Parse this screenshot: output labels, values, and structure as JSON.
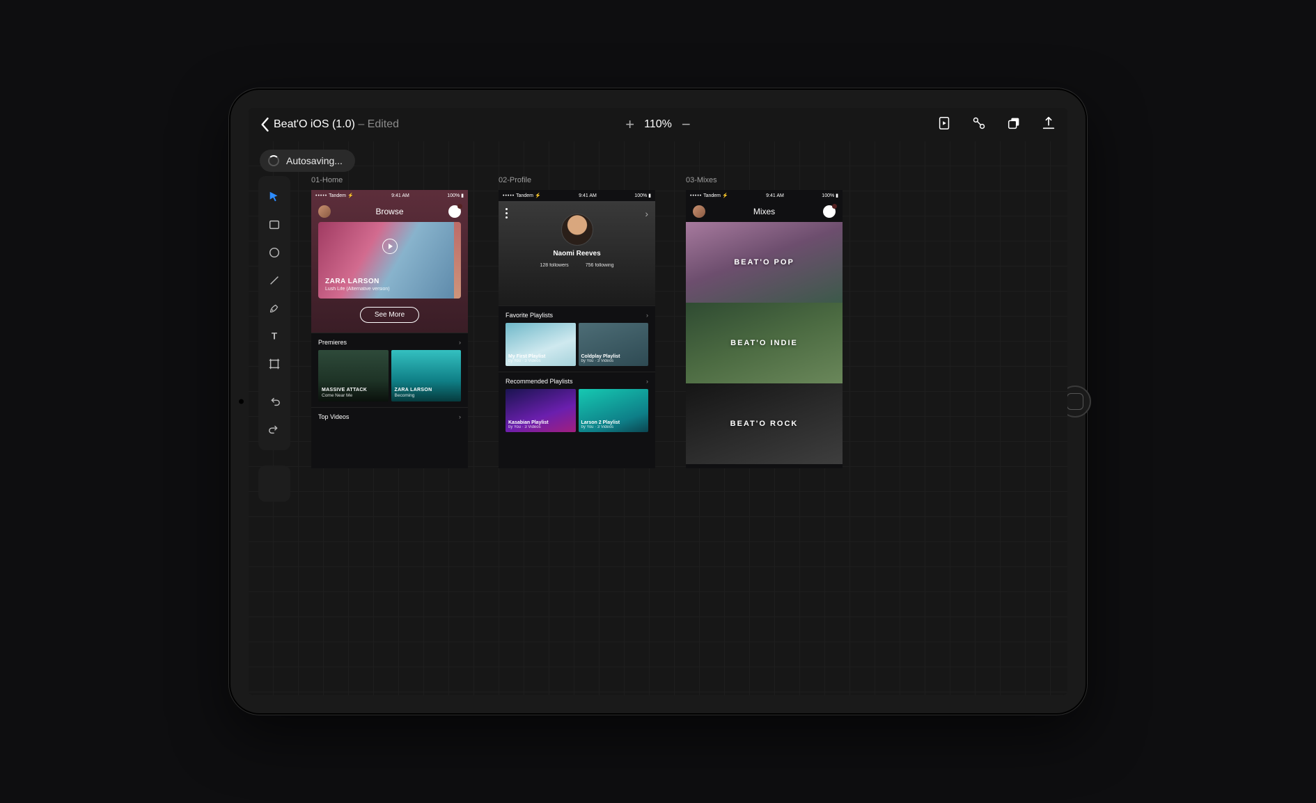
{
  "header": {
    "doc_title": "Beat'O iOS (1.0)",
    "doc_status": "Edited",
    "zoom": "110%"
  },
  "autosave": "Autosaving...",
  "phone_status": {
    "carrier": "Tandem",
    "time": "9:41 AM",
    "battery": "100%"
  },
  "artboards": {
    "a1": {
      "label": "01-Home",
      "nav_title": "Browse",
      "hero_artist": "ZARA LARSON",
      "hero_track": "Lush Life (Alternative version)",
      "see_more": "See More",
      "section_premieres": "Premieres",
      "premieres": [
        {
          "title": "MASSIVE ATTACK",
          "sub": "Come Near Me"
        },
        {
          "title": "ZARA LARSON",
          "sub": "Becoming"
        }
      ],
      "section_top": "Top Videos"
    },
    "a2": {
      "label": "02-Profile",
      "name": "Naomi Reeves",
      "followers_n": "128",
      "followers_l": "followers",
      "following_n": "756",
      "following_l": "following",
      "section_fav": "Favorite Playlists",
      "fav": [
        {
          "title": "My First Playlist",
          "sub": "by You · 3 Videos"
        },
        {
          "title": "Coldplay Playlist",
          "sub": "by You · 3 Videos"
        }
      ],
      "section_rec": "Recommended Playlists",
      "rec": [
        {
          "title": "Kasabian Playlist",
          "sub": "by You · 3 Videos"
        },
        {
          "title": "Larson 2 Playlist",
          "sub": "by You · 3 Videos"
        }
      ]
    },
    "a3": {
      "label": "03-Mixes",
      "nav_title": "Mixes",
      "mixes": [
        "BEAT'O POP",
        "BEAT'O INDIE",
        "BEAT'O ROCK"
      ]
    }
  }
}
